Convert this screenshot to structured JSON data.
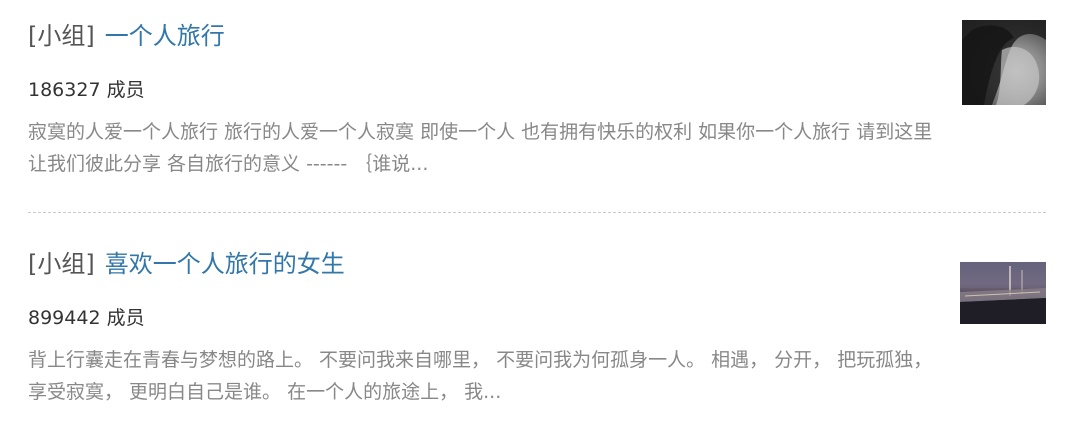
{
  "results": [
    {
      "tag": "[小组]",
      "title": "一个人旅行",
      "members": "186327 成员",
      "description": "寂寞的人爱一个人旅行 旅行的人爱一个人寂寞 即使一个人 也有拥有快乐的权利 如果你一个人旅行 请到这里 让我们彼此分享 各自旅行的意义 ------ ｛谁说...",
      "thumbnail_icon": "woman-portrait-thumbnail"
    },
    {
      "tag": "[小组]",
      "title": "喜欢一个人旅行的女生",
      "members": "899442 成员",
      "description": "背上行囊走在青春与梦想的路上。 不要问我来自哪里， 不要问我为何孤身一人。 相遇， 分开， 把玩孤独， 享受寂寞， 更明白自己是谁。 在一个人的旅途上， 我...",
      "thumbnail_icon": "dusk-road-thumbnail"
    }
  ],
  "colors": {
    "link": "#3377aa",
    "tag": "#555555",
    "members": "#333333",
    "description": "#888888",
    "separator": "#cccccc"
  }
}
